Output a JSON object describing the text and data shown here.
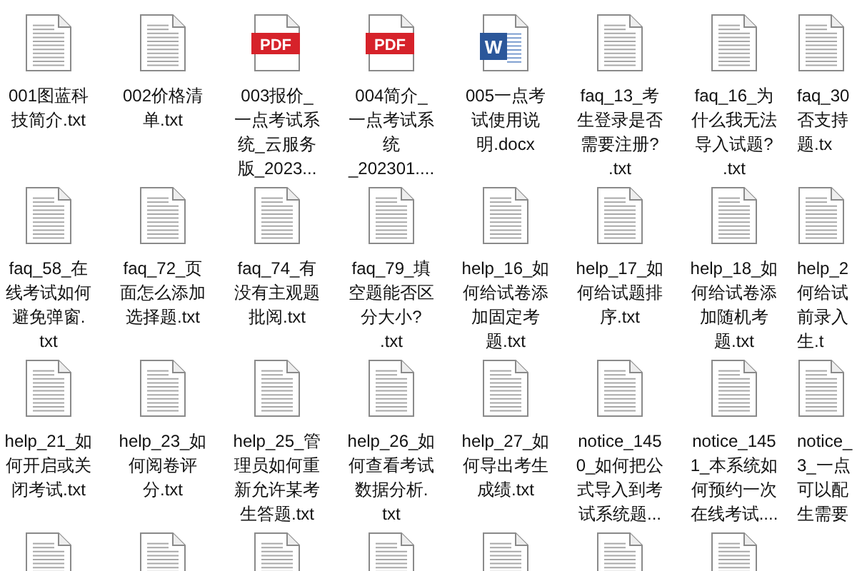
{
  "files": [
    {
      "kind": "txt",
      "lines": [
        "001图蓝科",
        "技简介.txt"
      ]
    },
    {
      "kind": "txt",
      "lines": [
        "002价格清",
        "单.txt"
      ]
    },
    {
      "kind": "pdf",
      "badge": "PDF",
      "lines": [
        "003报价_",
        "一点考试系",
        "统_云服务",
        "版_2023..."
      ]
    },
    {
      "kind": "pdf",
      "badge": "PDF",
      "lines": [
        "004简介_",
        "一点考试系",
        "统",
        "_202301...."
      ]
    },
    {
      "kind": "docx",
      "badge": "W",
      "lines": [
        "005一点考",
        "试使用说",
        "明.docx"
      ]
    },
    {
      "kind": "txt",
      "lines": [
        "faq_13_考",
        "生登录是否",
        "需要注册?",
        ".txt"
      ]
    },
    {
      "kind": "txt",
      "lines": [
        "faq_16_为",
        "什么我无法",
        "导入试题?",
        ".txt"
      ]
    },
    {
      "kind": "txt",
      "lines": [
        "faq_30",
        "否支持",
        "题.tx"
      ]
    },
    {
      "kind": "txt",
      "lines": [
        "faq_58_在",
        "线考试如何",
        "避免弹窗.",
        "txt"
      ]
    },
    {
      "kind": "txt",
      "lines": [
        "faq_72_页",
        "面怎么添加",
        "选择题.txt"
      ]
    },
    {
      "kind": "txt",
      "lines": [
        "faq_74_有",
        "没有主观题",
        "批阅.txt"
      ]
    },
    {
      "kind": "txt",
      "lines": [
        "faq_79_填",
        "空题能否区",
        "分大小?",
        ".txt"
      ]
    },
    {
      "kind": "txt",
      "lines": [
        "help_16_如",
        "何给试卷添",
        "加固定考",
        "题.txt"
      ]
    },
    {
      "kind": "txt",
      "lines": [
        "help_17_如",
        "何给试题排",
        "序.txt"
      ]
    },
    {
      "kind": "txt",
      "lines": [
        "help_18_如",
        "何给试卷添",
        "加随机考",
        "题.txt"
      ]
    },
    {
      "kind": "txt",
      "lines": [
        "help_2",
        "何给试",
        "前录入",
        "生.t"
      ]
    },
    {
      "kind": "txt",
      "lines": [
        "help_21_如",
        "何开启或关",
        "闭考试.txt"
      ]
    },
    {
      "kind": "txt",
      "lines": [
        "help_23_如",
        "何阅卷评",
        "分.txt"
      ]
    },
    {
      "kind": "txt",
      "lines": [
        "help_25_管",
        "理员如何重",
        "新允许某考",
        "生答题.txt"
      ]
    },
    {
      "kind": "txt",
      "lines": [
        "help_26_如",
        "何查看考试",
        "数据分析.",
        "txt"
      ]
    },
    {
      "kind": "txt",
      "lines": [
        "help_27_如",
        "何导出考生",
        "成绩.txt"
      ]
    },
    {
      "kind": "txt",
      "lines": [
        "notice_145",
        "0_如何把公",
        "式导入到考",
        "试系统题..."
      ]
    },
    {
      "kind": "txt",
      "lines": [
        "notice_145",
        "1_本系统如",
        "何预约一次",
        "在线考试...."
      ]
    },
    {
      "kind": "txt",
      "lines": [
        "notice_",
        "3_一点",
        "可以配",
        "生需要"
      ]
    },
    {
      "kind": "txt"
    },
    {
      "kind": "txt"
    },
    {
      "kind": "txt"
    },
    {
      "kind": "txt"
    },
    {
      "kind": "txt"
    },
    {
      "kind": "txt"
    },
    {
      "kind": "txt"
    }
  ]
}
